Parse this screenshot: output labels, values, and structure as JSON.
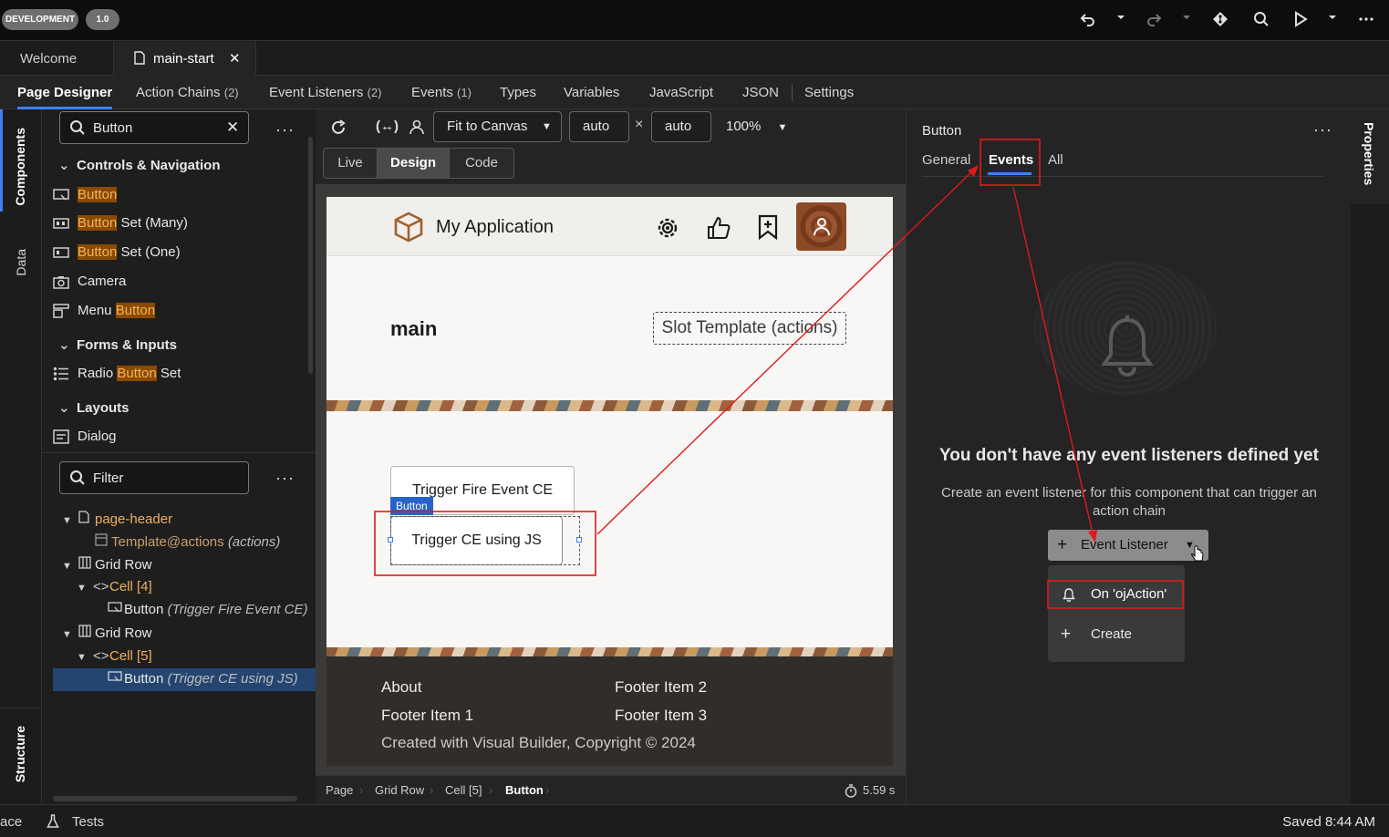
{
  "topbar": {
    "env_badge": "DEVELOPMENT",
    "version_badge": "1.0",
    "icons": [
      "undo-icon",
      "redo-icon",
      "git-icon",
      "search-icon",
      "run-icon",
      "more-icon"
    ]
  },
  "file_tabs": [
    {
      "label": "Welcome",
      "active": false
    },
    {
      "label": "main-start",
      "active": true
    }
  ],
  "nav_tabs": [
    {
      "label": "Page Designer",
      "count": ""
    },
    {
      "label": "Action Chains",
      "count": "(2)"
    },
    {
      "label": "Event Listeners",
      "count": "(2)"
    },
    {
      "label": "Events",
      "count": "(1)"
    },
    {
      "label": "Types",
      "count": ""
    },
    {
      "label": "Variables",
      "count": ""
    },
    {
      "label": "JavaScript",
      "count": ""
    },
    {
      "label": "JSON",
      "count": ""
    },
    {
      "label": "Settings",
      "count": ""
    }
  ],
  "left_rail": {
    "components": "Components",
    "data": "Data",
    "structure": "Structure"
  },
  "components": {
    "search_value": "Button",
    "groups": [
      {
        "label": "Controls & Navigation"
      },
      {
        "label": "Forms & Inputs"
      },
      {
        "label": "Layouts"
      }
    ],
    "items": [
      {
        "pre": "",
        "match": "Button",
        "post": ""
      },
      {
        "pre": "",
        "match": "Button",
        "post": " Set (Many)"
      },
      {
        "pre": "",
        "match": "Button",
        "post": " Set (One)"
      },
      {
        "pre": "Camera",
        "match": "",
        "post": ""
      },
      {
        "pre": "Menu ",
        "match": "Button",
        "post": ""
      },
      {
        "pre": "Radio ",
        "match": "Button",
        "post": " Set"
      },
      {
        "pre": "Dialog",
        "match": "",
        "post": ""
      }
    ]
  },
  "structure": {
    "filter_placeholder": "Filter",
    "nodes": [
      {
        "label": "page-header",
        "extra": ""
      },
      {
        "label": "Template",
        "extra": "@actions",
        "italic": "(actions)"
      },
      {
        "label": "Grid Row",
        "extra": ""
      },
      {
        "label": "Cell [4]",
        "extra": ""
      },
      {
        "label": "Button",
        "italic": "(Trigger Fire Event CE)"
      },
      {
        "label": "Grid Row",
        "extra": ""
      },
      {
        "label": "Cell [5]",
        "extra": ""
      },
      {
        "label": "Button",
        "italic": "(Trigger CE using JS)"
      }
    ]
  },
  "canvas_toolbar": {
    "fit": "Fit to Canvas",
    "width": "auto",
    "times": "×",
    "height": "auto",
    "zoom": "100%",
    "modes": [
      "Live",
      "Design",
      "Code"
    ]
  },
  "preview": {
    "app_title": "My Application",
    "main_heading": "main",
    "slot_template": "Slot Template (actions)",
    "button1": "Trigger Fire Event CE",
    "button2": "Trigger CE using JS",
    "selected_tag": "Button",
    "footer": {
      "about": "About",
      "item1": "Footer Item 1",
      "item2": "Footer Item 2",
      "item3": "Footer Item 3",
      "copyright": "Created with Visual Builder, Copyright © 2024"
    }
  },
  "breadcrumb": {
    "items": [
      "Page",
      "Grid Row",
      "Cell [5]",
      "Button"
    ],
    "timer": "5.59 s"
  },
  "properties": {
    "title": "Button",
    "tabs": [
      "General",
      "Events",
      "All"
    ],
    "empty_title": "You don't have any event listeners defined yet",
    "empty_desc": "Create an event listener for this component that can trigger an action chain",
    "add_button": "Event Listener",
    "menu": [
      "On 'ojAction'",
      "Create"
    ],
    "rail_label": "Properties"
  },
  "statusbar": {
    "left": "ace",
    "tests": "Tests",
    "saved": "Saved 8:44 AM"
  },
  "colors": {
    "accent": "#3b82f6",
    "annotation": "#e0191b",
    "highlight": "#8a4a00"
  }
}
